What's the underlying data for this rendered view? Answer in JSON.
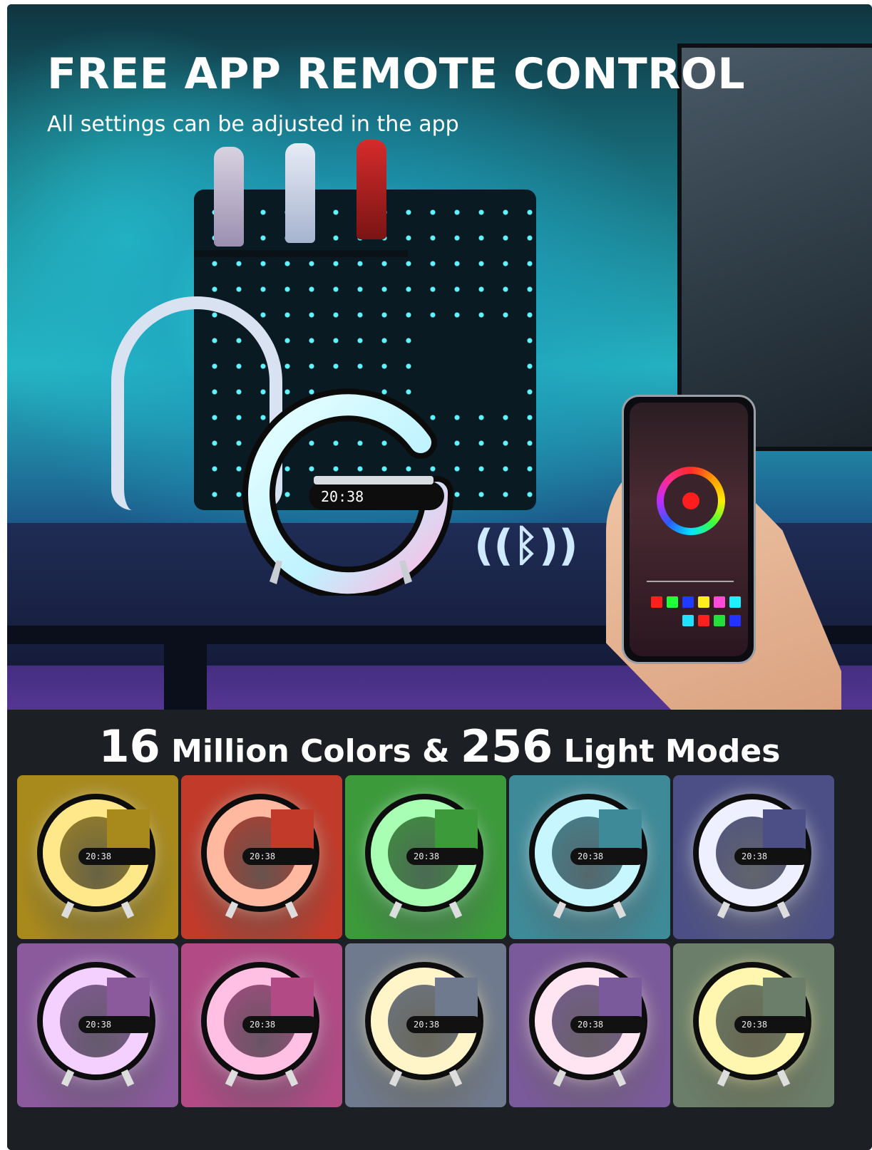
{
  "hero": {
    "title": "FREE APP REMOTE CONTROL",
    "subtitle": "All settings can be adjusted in the app",
    "lamp_clock": "20:38"
  },
  "colors": {
    "count": "16",
    "count_label": " Million Colors & ",
    "modes": "256",
    "modes_label": " Light Modes"
  },
  "swatches": [
    {
      "bg": "#a8891c",
      "glow": "#ffe88a",
      "name": "yellow"
    },
    {
      "bg": "#c23a2a",
      "glow": "#ffb9a1",
      "name": "red"
    },
    {
      "bg": "#3c9a3a",
      "glow": "#a8ffb3",
      "name": "green"
    },
    {
      "bg": "#3e8a98",
      "glow": "#c7f6ff",
      "name": "cyan"
    },
    {
      "bg": "#4b4f86",
      "glow": "#eef0ff",
      "name": "indigo"
    },
    {
      "bg": "#8a5a9c",
      "glow": "#f3d0ff",
      "name": "violet"
    },
    {
      "bg": "#b24a86",
      "glow": "#ffc0e4",
      "name": "pink"
    },
    {
      "bg": "#6f7a8e",
      "glow": "#fff5c9",
      "name": "white-gradient"
    },
    {
      "bg": "#7a5a9a",
      "glow": "#ffe4f1",
      "name": "lilac"
    },
    {
      "bg": "#6a7e6a",
      "glow": "#fff7b0",
      "name": "spring"
    }
  ],
  "tile_clock": "20:38"
}
